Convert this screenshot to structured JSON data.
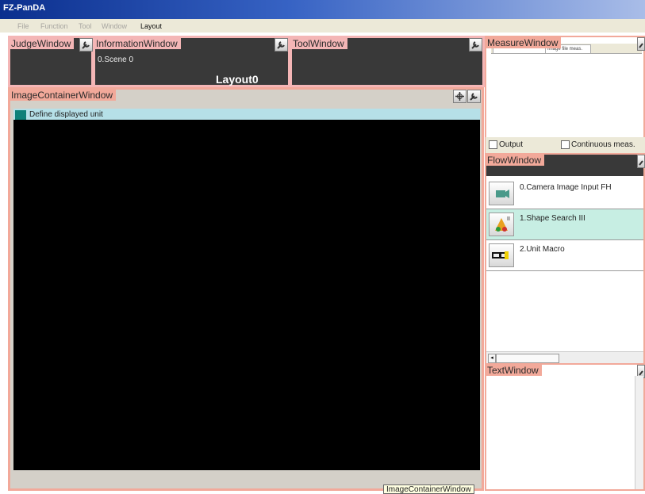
{
  "app": {
    "title": "FZ-PanDA"
  },
  "menu": {
    "items": [
      "File",
      "Function",
      "Tool",
      "Window",
      "Layout"
    ]
  },
  "judge_window": {
    "title": "JudgeWindow"
  },
  "information_window": {
    "title": "InformationWindow",
    "scene": "0.Scene 0",
    "layout": "Layout0"
  },
  "tool_window": {
    "title": "ToolWindow"
  },
  "measure_window": {
    "title": "MeasureWindow",
    "tabs": [
      "",
      "Image file meas."
    ],
    "output_label": "Output",
    "continuous_label": "Continuous meas."
  },
  "image_container_window": {
    "title": "ImageContainerWindow",
    "define_label": "Define displayed unit",
    "tooltip": "ImageContainerWindow"
  },
  "flow_window": {
    "title": "FlowWindow",
    "items": [
      {
        "label": "0.Camera Image Input FH",
        "selected": false
      },
      {
        "label": "1.Shape Search III",
        "selected": true
      },
      {
        "label": "2.Unit Macro",
        "selected": false
      }
    ]
  },
  "text_window": {
    "title": "TextWindow"
  },
  "colors": {
    "panel_border": "#f4b6b6",
    "panel_bg": "#393939",
    "selected_row": "#c7eee3",
    "define_bar": "#b6e0e8"
  }
}
